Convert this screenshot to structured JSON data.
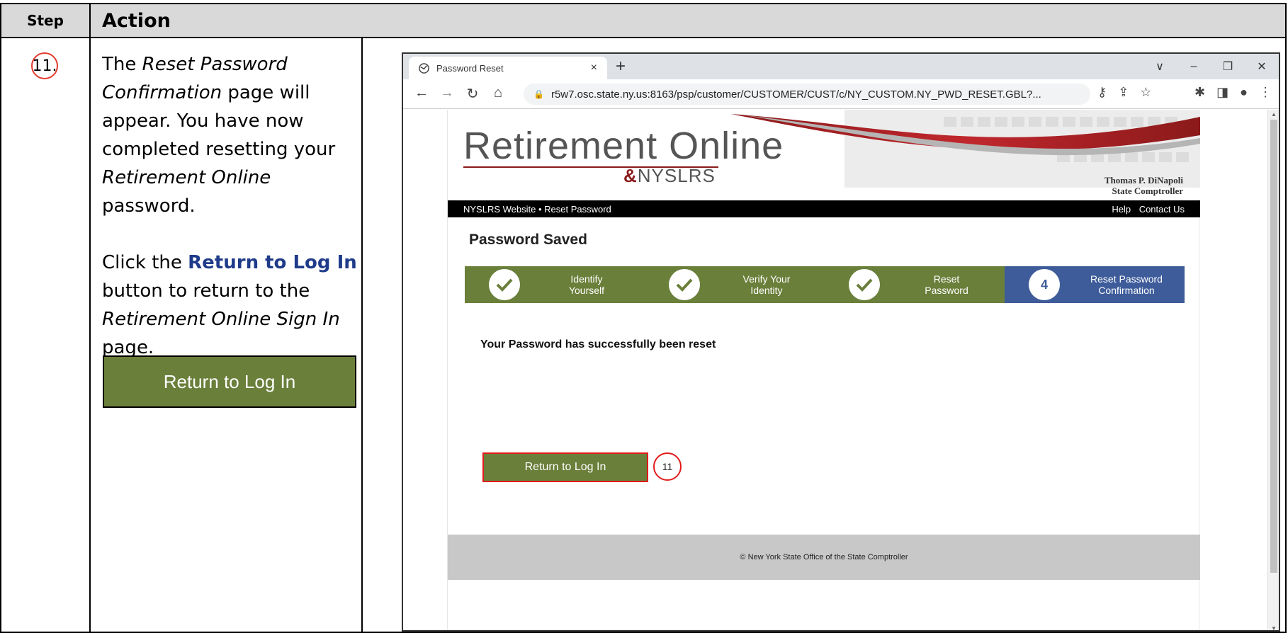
{
  "table": {
    "header_step": "Step",
    "header_action": "Action",
    "step_number": "11."
  },
  "instructions": {
    "p1_a": "The ",
    "p1_em1": "Reset Password Confirmation",
    "p1_b": " page will appear. You have now completed resetting your ",
    "p1_em2": "Retirement Online",
    "p1_c": " password.",
    "p2_a": "Click the ",
    "p2_btn": "Return to Log In",
    "p2_b": " button to return to the ",
    "p2_em": "Retirement Online Sign In",
    "p2_c": " page.",
    "button_label": "Return to Log In"
  },
  "browser": {
    "tab_title": "Password Reset",
    "tab_close": "×",
    "new_tab": "+",
    "url": "r5w7.osc.state.ny.us:8163/psp/customer/CUSTOMER/CUST/c/NY_CUSTOM.NY_PWD_RESET.GBL?...",
    "window_controls": [
      "∨",
      "–",
      "❐",
      "✕"
    ]
  },
  "site": {
    "logo_main": "Retirement Online",
    "logo_sub": "NYSLRS",
    "comptroller_name": "Thomas P. DiNapoli",
    "comptroller_title": "State Comptroller",
    "nav_left": "NYSLRS Website • Reset Password",
    "nav_help": "Help",
    "nav_contact": "Contact Us",
    "heading": "Password Saved",
    "steps": [
      {
        "label_line1": "Identify",
        "label_line2": "Yourself",
        "state": "done"
      },
      {
        "label_line1": "Verify Your",
        "label_line2": "Identity",
        "state": "done"
      },
      {
        "label_line1": "Reset",
        "label_line2": "Password",
        "state": "done"
      },
      {
        "label_line1": "Reset Password",
        "label_line2": "Confirmation",
        "state": "active",
        "number": "4"
      }
    ],
    "success_message": "Your Password has successfully been reset",
    "button_label": "Return to Log In",
    "callout_number": "11",
    "footer_text": "© New York State Office of the State Comptroller"
  },
  "colors": {
    "green": "#6a7f3a",
    "blue": "#3e5c9a",
    "highlight_red": "#e21a1a",
    "brand_maroon": "#8b1a1a"
  }
}
